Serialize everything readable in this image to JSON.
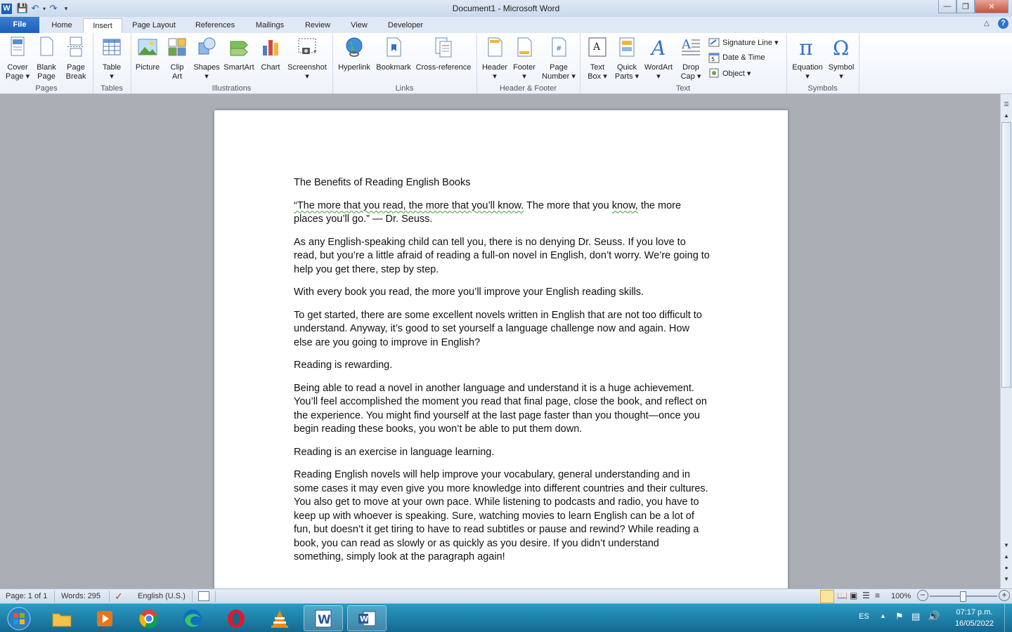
{
  "window": {
    "title": "Document1  -  Microsoft Word",
    "minimize_glyph": "—",
    "maximize_glyph": "❐",
    "close_glyph": "✕"
  },
  "tabs": [
    "File",
    "Home",
    "Insert",
    "Page Layout",
    "References",
    "Mailings",
    "Review",
    "View",
    "Developer"
  ],
  "active_tab": "Insert",
  "ribbon": {
    "groups": {
      "pages": "Pages",
      "tables": "Tables",
      "illustrations": "Illustrations",
      "links": "Links",
      "header_footer": "Header & Footer",
      "text": "Text",
      "symbols": "Symbols"
    },
    "buttons": {
      "cover_page": [
        "Cover",
        "Page ▾"
      ],
      "blank_page": [
        "Blank",
        "Page"
      ],
      "page_break": [
        "Page",
        "Break"
      ],
      "table": [
        "Table",
        "▾"
      ],
      "picture": [
        "Picture",
        ""
      ],
      "clip_art": [
        "Clip",
        "Art"
      ],
      "shapes": [
        "Shapes",
        "▾"
      ],
      "smartart": [
        "SmartArt",
        ""
      ],
      "chart": [
        "Chart",
        ""
      ],
      "screenshot": [
        "Screenshot",
        "▾"
      ],
      "hyperlink": [
        "Hyperlink",
        ""
      ],
      "bookmark": [
        "Bookmark",
        ""
      ],
      "cross_reference": [
        "Cross-reference",
        ""
      ],
      "header": [
        "Header",
        "▾"
      ],
      "footer": [
        "Footer",
        "▾"
      ],
      "page_number": [
        "Page",
        "Number ▾"
      ],
      "text_box": [
        "Text",
        "Box ▾"
      ],
      "quick_parts": [
        "Quick",
        "Parts ▾"
      ],
      "wordart": [
        "WordArt",
        "▾"
      ],
      "drop_cap": [
        "Drop",
        "Cap ▾"
      ],
      "equation": [
        "Equation",
        "▾"
      ],
      "symbol": [
        "Symbol",
        "▾"
      ]
    },
    "small_buttons": {
      "signature_line": "Signature Line ▾",
      "date_time": "Date & Time",
      "object": "Object ▾"
    }
  },
  "document": {
    "paragraphs": [
      "The Benefits of Reading English Books",
      "“The more that you read, the more that you’ll know. The more that you know, the more places you’ll go.” — Dr. Seuss.",
      "As any English-speaking child can tell you, there is no denying Dr. Seuss. If you love to read, but you’re a little afraid of reading a full-on novel in English, don’t worry. We’re going to help you get there, step by step.",
      "With every book you read, the more you’ll improve your English reading skills.",
      "To get started, there are some excellent novels written in English that are not too difficult to understand. Anyway, it’s good to set yourself a language challenge now and again. How else are you going to improve in English?",
      "Reading is rewarding.",
      "Being able to read a novel in another language and understand it is a huge achievement. You’ll feel accomplished the moment you read that final page, close the book, and reflect on the experience. You might find yourself at the last page faster than you thought—once you begin reading these books, you won’t be able to put them down.",
      "Reading is an exercise in language learning.",
      "Reading English novels will help improve your vocabulary, general understanding and in some cases it may even give you more knowledge into different countries and their cultures. You also get to move at your own pace. While listening to podcasts and radio, you have to keep up with whoever is speaking. Sure, watching movies to learn English can be a lot of fun, but doesn’t it get tiring to have to read subtitles or pause and rewind? While reading a book, you can read as slowly or as quickly as you desire. If you didn’t understand something, simply look at the paragraph again!"
    ],
    "quote_underlined_1": "“The more that you read, the more that you’ll know.",
    "quote_rest_1": " The more that you ",
    "quote_underlined_2": "know,",
    "quote_rest_2": " the more places you’ll go.” — Dr. Seuss."
  },
  "status": {
    "page": "Page: 1 of 1",
    "words": "Words: 295",
    "language": "English (U.S.)",
    "zoom": "100%",
    "zoom_minus": "−",
    "zoom_plus": "+"
  },
  "taskbar": {
    "lang": "ES",
    "time": "07:17 p.m.",
    "date": "16/05/2022"
  },
  "colors": {
    "accent": "#1b5fb8",
    "taskbar": "#14678f"
  }
}
